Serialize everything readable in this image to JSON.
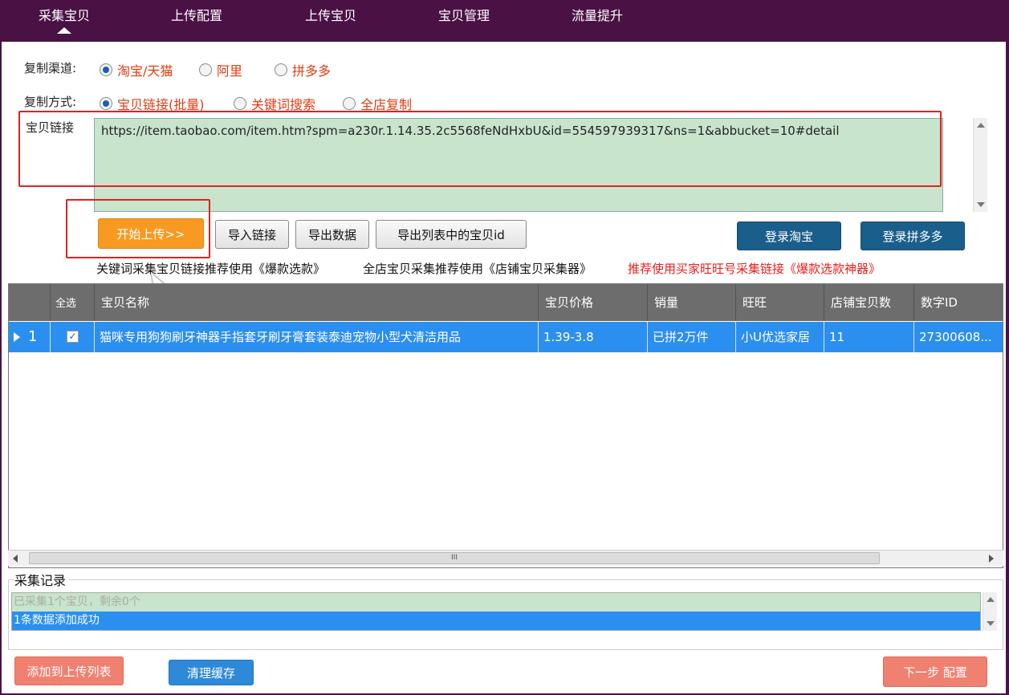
{
  "nav": {
    "tabs": [
      {
        "label": "采集宝贝"
      },
      {
        "label": "上传配置"
      },
      {
        "label": "上传宝贝"
      },
      {
        "label": "宝贝管理"
      },
      {
        "label": "流量提升"
      }
    ]
  },
  "channel": {
    "label": "复制渠道:",
    "options": [
      "淘宝/天猫",
      "阿里",
      "拼多多"
    ],
    "selected": "淘宝/天猫"
  },
  "method": {
    "label": "复制方式:",
    "options": [
      "宝贝链接(批量)",
      "关键词搜索",
      "全店复制"
    ],
    "selected": "宝贝链接(批量)"
  },
  "link": {
    "label": "宝贝链接",
    "value": "https://item.taobao.com/item.htm?spm=a230r.1.14.35.2c5568feNdHxbU&id=554597939317&ns=1&abbucket=10#detail"
  },
  "buttons": {
    "start": "开始上传>>",
    "import": "导入链接",
    "export": "导出数据",
    "export_ids": "导出列表中的宝贝id",
    "login_taobao": "登录淘宝",
    "login_pdd": "登录拼多多",
    "add_upload": "添加到上传列表",
    "clear_cache": "清理缓存",
    "next": "下一步 配置"
  },
  "tips": {
    "keyword": "关键词采集宝贝链接推荐使用《爆款选款》",
    "shop": "全店宝贝采集推荐使用《店铺宝贝采集器》",
    "wangwang": "推荐使用买家旺旺号采集链接《爆款选款神器》"
  },
  "table": {
    "columns": [
      "",
      "全选",
      "宝贝名称",
      "宝贝价格",
      "销量",
      "旺旺",
      "店铺宝贝数",
      "数字ID"
    ],
    "rows": [
      {
        "index": "1",
        "checked": true,
        "name": "猫咪专用狗狗刷牙神器手指套牙刷牙膏套装泰迪宠物小型犬清洁用品",
        "price": "1.39-3.8",
        "sales": "已拼2万件",
        "wangwang": "小U优选家居",
        "shop_count": "11",
        "id": "27300608..."
      }
    ],
    "scroll_grip": "III"
  },
  "log": {
    "title": "采集记录",
    "items": [
      "已采集1个宝贝，剩余0个",
      "1条数据添加成功"
    ]
  },
  "colors": {
    "accent": "#4a1244",
    "selection": "#2b8ff0",
    "warning": "#e42020"
  }
}
